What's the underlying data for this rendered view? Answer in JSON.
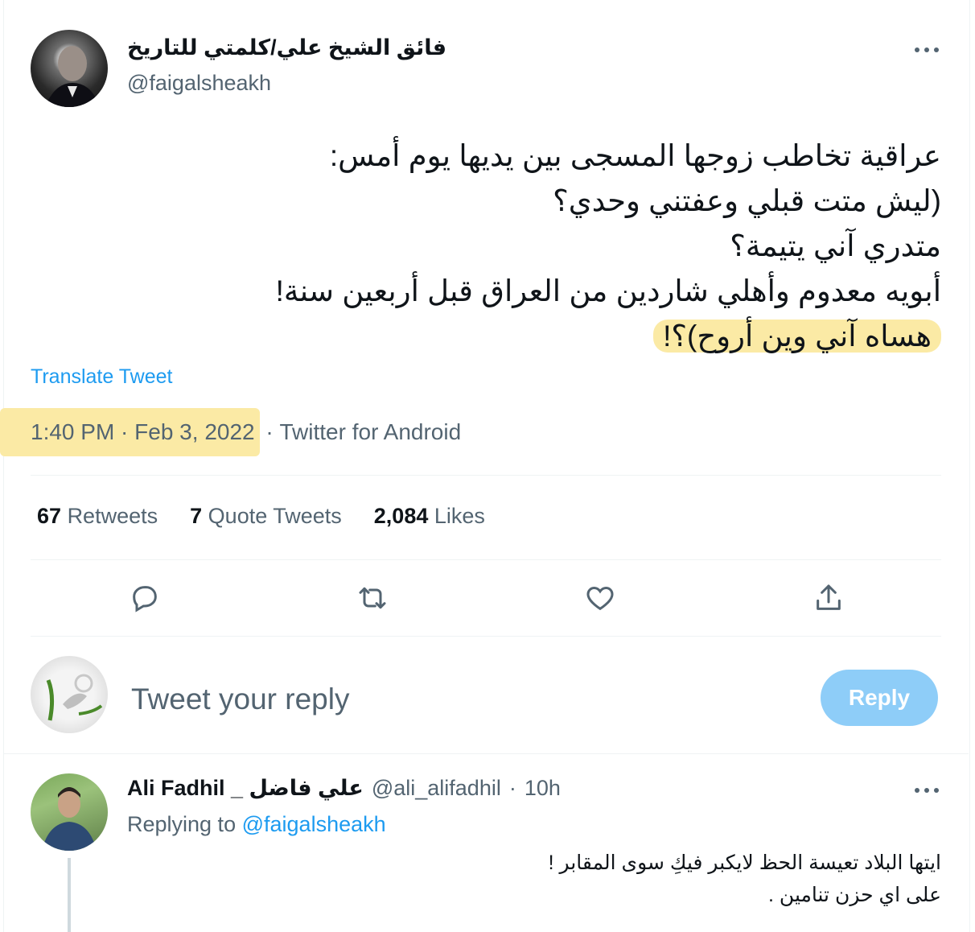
{
  "tweet": {
    "display_name": "فائق الشيخ علي/كلمتي للتاريخ",
    "handle": "@faigalsheakh",
    "more_icon": "more-icon",
    "text_lines": [
      "عراقية تخاطب زوجها المسجى بين يديها يوم أمس:",
      "(ليش متت قبلي وعفتني وحدي؟",
      "متدري آني يتيمة؟",
      "أبويه معدوم وأهلي شاردين من العراق قبل أربعين سنة!",
      "هساه آني وين أروح)؟!"
    ],
    "translate_label": "Translate Tweet",
    "timestamp": "1:40 PM · Feb 3, 2022",
    "separator": " · ",
    "source": "Twitter for Android",
    "stats": {
      "retweets_count": "67",
      "retweets_label": "Retweets",
      "quotes_count": "7",
      "quotes_label": "Quote Tweets",
      "likes_count": "2,084",
      "likes_label": "Likes"
    },
    "highlight_color": "#fbeaa5"
  },
  "reply_box": {
    "placeholder": "Tweet your reply",
    "button_label": "Reply"
  },
  "reply_tweet": {
    "display_name": "Ali Fadhil _ علي فاضل",
    "handle": "@ali_alifadhil",
    "dot": "·",
    "time": "10h",
    "replying_prefix": "Replying to",
    "replying_to": "@faigalsheakh",
    "text_lines": [
      "ايتها البلاد تعيسة الحظ لايكبر فيكِ سوى المقابر !",
      "على اي حزن تنامين ."
    ]
  },
  "colors": {
    "accent": "#1d9bf0",
    "reply_button": "#8ecdf8",
    "secondary_text": "#536471"
  }
}
